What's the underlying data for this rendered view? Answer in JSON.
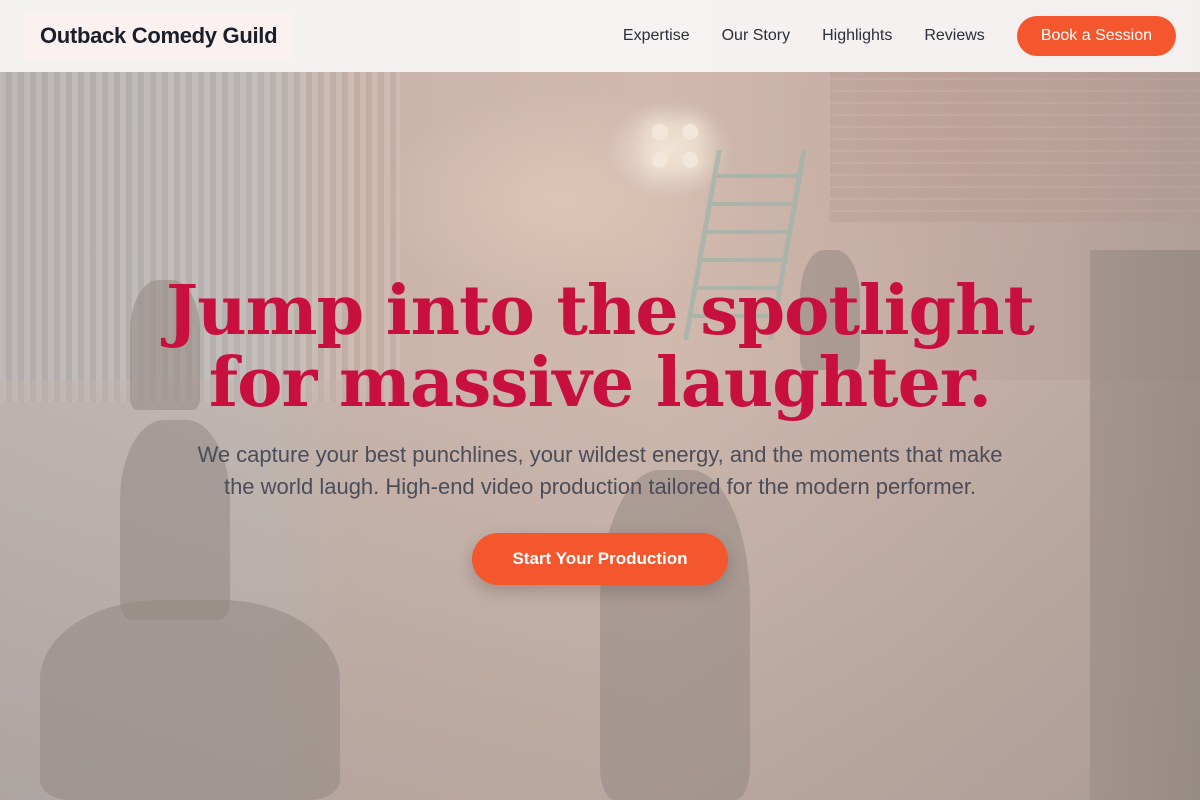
{
  "header": {
    "brand": "Outback Comedy Guild",
    "nav": [
      "Expertise",
      "Our Story",
      "Highlights",
      "Reviews"
    ],
    "cta": "Book a Session"
  },
  "hero": {
    "headline_line1": "Jump into the spotlight",
    "headline_line2": "for massive laughter.",
    "subtitle": "We capture your best punchlines, your wildest energy, and the moments that make the world laugh. High-end video production tailored for the modern performer.",
    "cta": "Start Your Production"
  },
  "colors": {
    "accent": "#f4562e",
    "headline": "#c8103f"
  }
}
